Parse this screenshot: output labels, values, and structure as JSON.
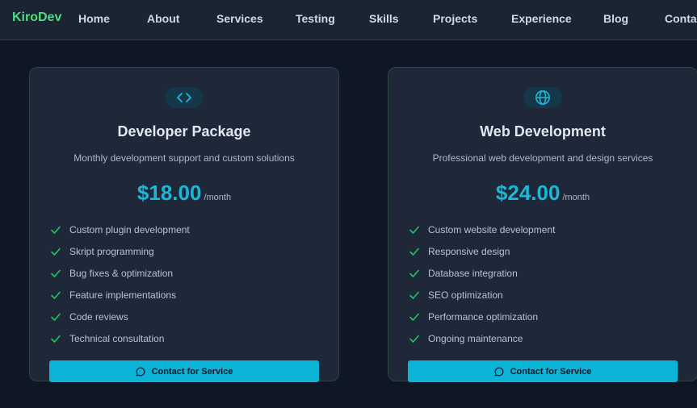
{
  "brand": "KiroDev",
  "nav": [
    "Home",
    "About",
    "Services",
    "Testing",
    "Skills",
    "Projects",
    "Experience",
    "Blog",
    "Contact"
  ],
  "cards": [
    {
      "icon": "code-icon",
      "title": "Developer Package",
      "description": "Monthly development support and custom solutions",
      "price": "$18.00",
      "period": "/month",
      "features": [
        "Custom plugin development",
        "Skript programming",
        "Bug fixes & optimization",
        "Feature implementations",
        "Code reviews",
        "Technical consultation"
      ],
      "cta": "Contact for Service"
    },
    {
      "icon": "globe-icon",
      "title": "Web Development",
      "description": "Professional web development and design services",
      "price": "$24.00",
      "period": "/month",
      "features": [
        "Custom website development",
        "Responsive design",
        "Database integration",
        "SEO optimization",
        "Performance optimization",
        "Ongoing maintenance"
      ],
      "cta": "Contact for Service"
    }
  ],
  "colors": {
    "accent": "#0bb3d7",
    "brand": "#4ade80",
    "check": "#22c55e",
    "background": "#0f1727",
    "card": "#1e2838"
  }
}
